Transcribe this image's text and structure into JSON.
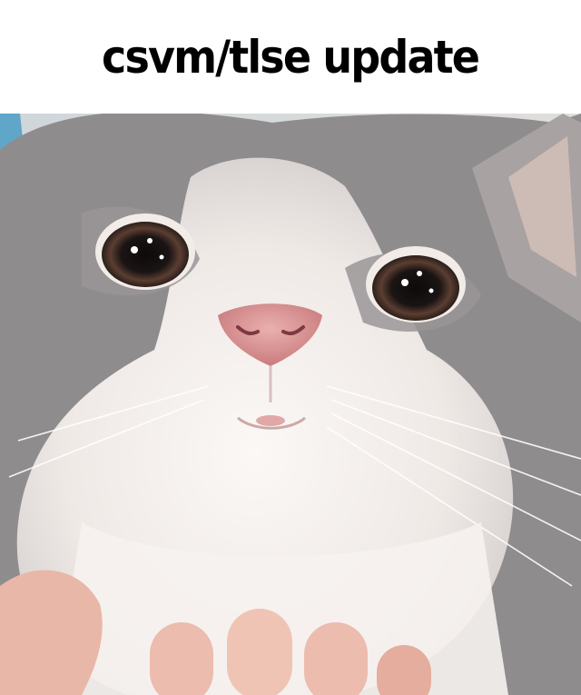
{
  "caption": {
    "text": "csvm/tlse update"
  },
  "photo": {
    "subject": "surprised-cat",
    "colors": {
      "fur_gray": "#8f8c8e",
      "fur_white": "#f3efec",
      "nose_pink": "#d98f8f",
      "eye_dark": "#1a1414",
      "iris_brown": "#6b4a3a",
      "hand_skin": "#e9b7a7",
      "background": "#e9e1da"
    }
  }
}
